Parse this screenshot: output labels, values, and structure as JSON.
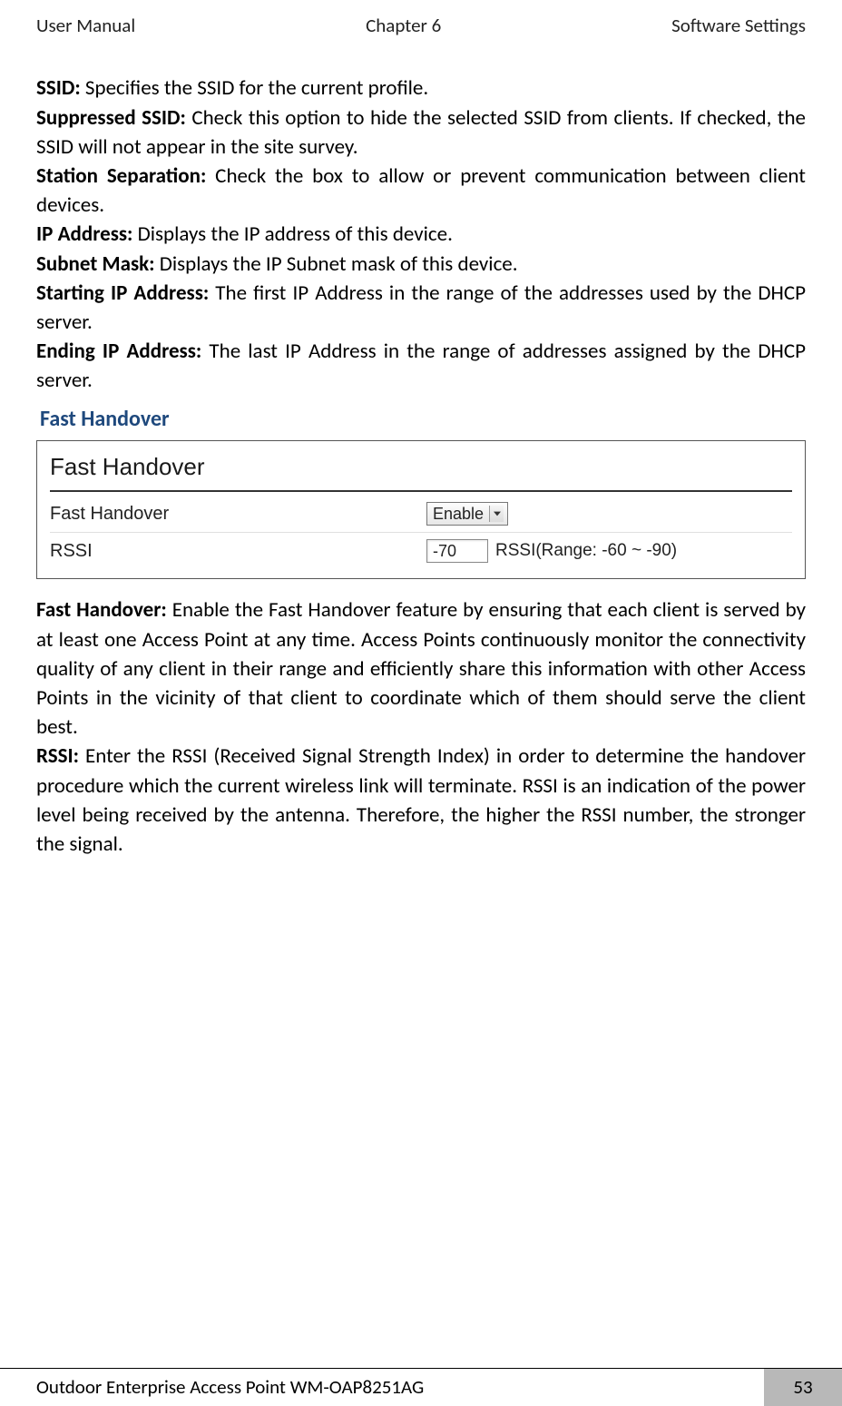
{
  "header": {
    "left": "User Manual",
    "center": "Chapter 6",
    "right": "Software Settings"
  },
  "defs": {
    "ssid": {
      "term": "SSID:",
      "text": " Specifies the SSID for the current profile."
    },
    "suppressed": {
      "term": "Suppressed SSID:",
      "text": " Check this option to hide the selected SSID from clients. If checked, the SSID will not appear in the site survey."
    },
    "station": {
      "term": "Station Separation:",
      "text": " Check the box to allow or prevent communication between client devices."
    },
    "ip": {
      "term": "IP Address:",
      "text": " Displays the IP address of this device."
    },
    "subnet": {
      "term": "Subnet Mask:",
      "text": " Displays the IP Subnet mask of this device."
    },
    "starting": {
      "term": "Starting IP Address:",
      "text": " The first IP Address in the range of the addresses used by the DHCP server."
    },
    "ending": {
      "term": "Ending IP Address:",
      "text": " The last IP Address in the range of addresses assigned by the DHCP server."
    }
  },
  "section_heading": "Fast Handover",
  "panel": {
    "title": "Fast Handover",
    "row1_label": "Fast Handover",
    "row1_value": "Enable",
    "row2_label": "RSSI",
    "row2_value": "-70",
    "row2_note": "RSSI(Range: -60 ~ -90)"
  },
  "post": {
    "fh": {
      "term": "Fast Handover:",
      "text": " Enable the Fast Handover feature by ensuring that each client is served by at least one Access Point at any time. Access Points continuously monitor the connectivity quality of any client in their range and efficiently share this information with other Access Points in the vicinity of that client to coordinate which of them should serve the client best."
    },
    "rssi": {
      "term": "RSSI:",
      "text": " Enter the RSSI (Received Signal Strength Index) in order to determine the handover procedure which the current wireless link will terminate. RSSI is an indication of the power level being received by the antenna. Therefore, the higher the RSSI number, the stronger the signal."
    }
  },
  "footer": {
    "title": "Outdoor Enterprise Access Point WM-OAP8251AG",
    "page": "53"
  }
}
